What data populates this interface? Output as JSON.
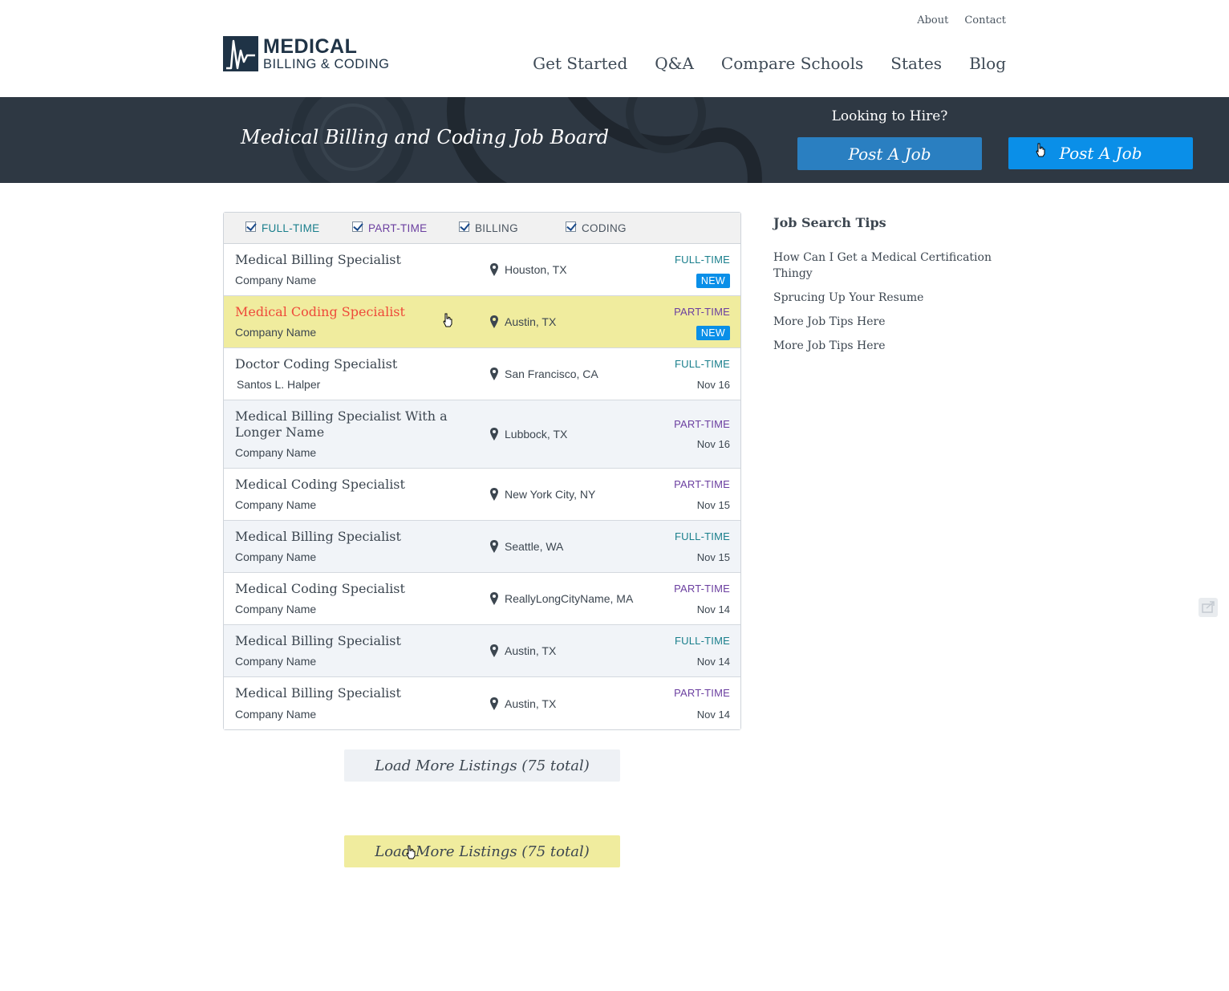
{
  "header": {
    "top_links": [
      "About",
      "Contact"
    ],
    "logo": {
      "line1": "MEDICAL",
      "line2": "BILLING & CODING"
    },
    "nav": [
      "Get Started",
      "Q&A",
      "Compare Schools",
      "States",
      "Blog"
    ]
  },
  "banner": {
    "title": "Medical Billing and Coding Job Board",
    "hire_label": "Looking to Hire?",
    "post_button": "Post A Job",
    "post_button_hover": "Post A Job"
  },
  "filters": [
    {
      "label": "FULL-TIME",
      "checked": true
    },
    {
      "label": "PART-TIME",
      "checked": true
    },
    {
      "label": "BILLING",
      "checked": true
    },
    {
      "label": "CODING",
      "checked": true
    }
  ],
  "jobs": [
    {
      "title": "Medical Billing Specialist",
      "company": "Company Name",
      "location": "Houston, TX",
      "type": "FULL-TIME",
      "meta": "NEW"
    },
    {
      "title": "Medical Coding Specialist",
      "company": "Company Name",
      "location": "Austin, TX",
      "type": "PART-TIME",
      "meta": "NEW"
    },
    {
      "title": "Doctor Coding Specialist",
      "company": "Santos L. Halper",
      "location": "San Francisco, CA",
      "type": "FULL-TIME",
      "meta": "Nov 16"
    },
    {
      "title": "Medical Billing Specialist With a Longer Name",
      "company": "Company Name",
      "location": "Lubbock, TX",
      "type": "PART-TIME",
      "meta": "Nov 16"
    },
    {
      "title": "Medical Coding Specialist",
      "company": "Company Name",
      "location": "New York City, NY",
      "type": "PART-TIME",
      "meta": "Nov 15"
    },
    {
      "title": "Medical Billing Specialist",
      "company": "Company Name",
      "location": "Seattle, WA",
      "type": "FULL-TIME",
      "meta": "Nov 15"
    },
    {
      "title": "Medical Coding Specialist",
      "company": "Company Name",
      "location": "ReallyLongCityName, MA",
      "type": "PART-TIME",
      "meta": "Nov 14"
    },
    {
      "title": "Medical Billing Specialist",
      "company": "Company Name",
      "location": "Austin, TX",
      "type": "FULL-TIME",
      "meta": "Nov 14"
    },
    {
      "title": "Medical Billing Specialist",
      "company": "Company Name",
      "location": "Austin, TX",
      "type": "PART-TIME",
      "meta": "Nov 14"
    }
  ],
  "load_more": {
    "label": "Load More Listings (75 total)",
    "label_hover": "Load More Listings (75 total)"
  },
  "sidebar": {
    "heading": "Job Search Tips",
    "links": [
      "How Can I Get a Medical Certification Thingy",
      "Sprucing Up Your Resume",
      "More Job Tips Here",
      "More Job Tips Here"
    ]
  },
  "colors": {
    "banner_bg": "#2e3843",
    "post_button": "#2a7fc1",
    "post_button_hover": "#0a8fe8",
    "full_time": "#1a7f8c",
    "part_time": "#6b3fa0",
    "highlight_row": "#f0ec9e",
    "highlight_title": "#ee4a3a",
    "new_badge": "#0a8fe8"
  },
  "icons": [
    "heartbeat-logo-icon",
    "checkbox-checked-icon",
    "map-pin-icon",
    "pointer-cursor-icon",
    "share-icon"
  ]
}
